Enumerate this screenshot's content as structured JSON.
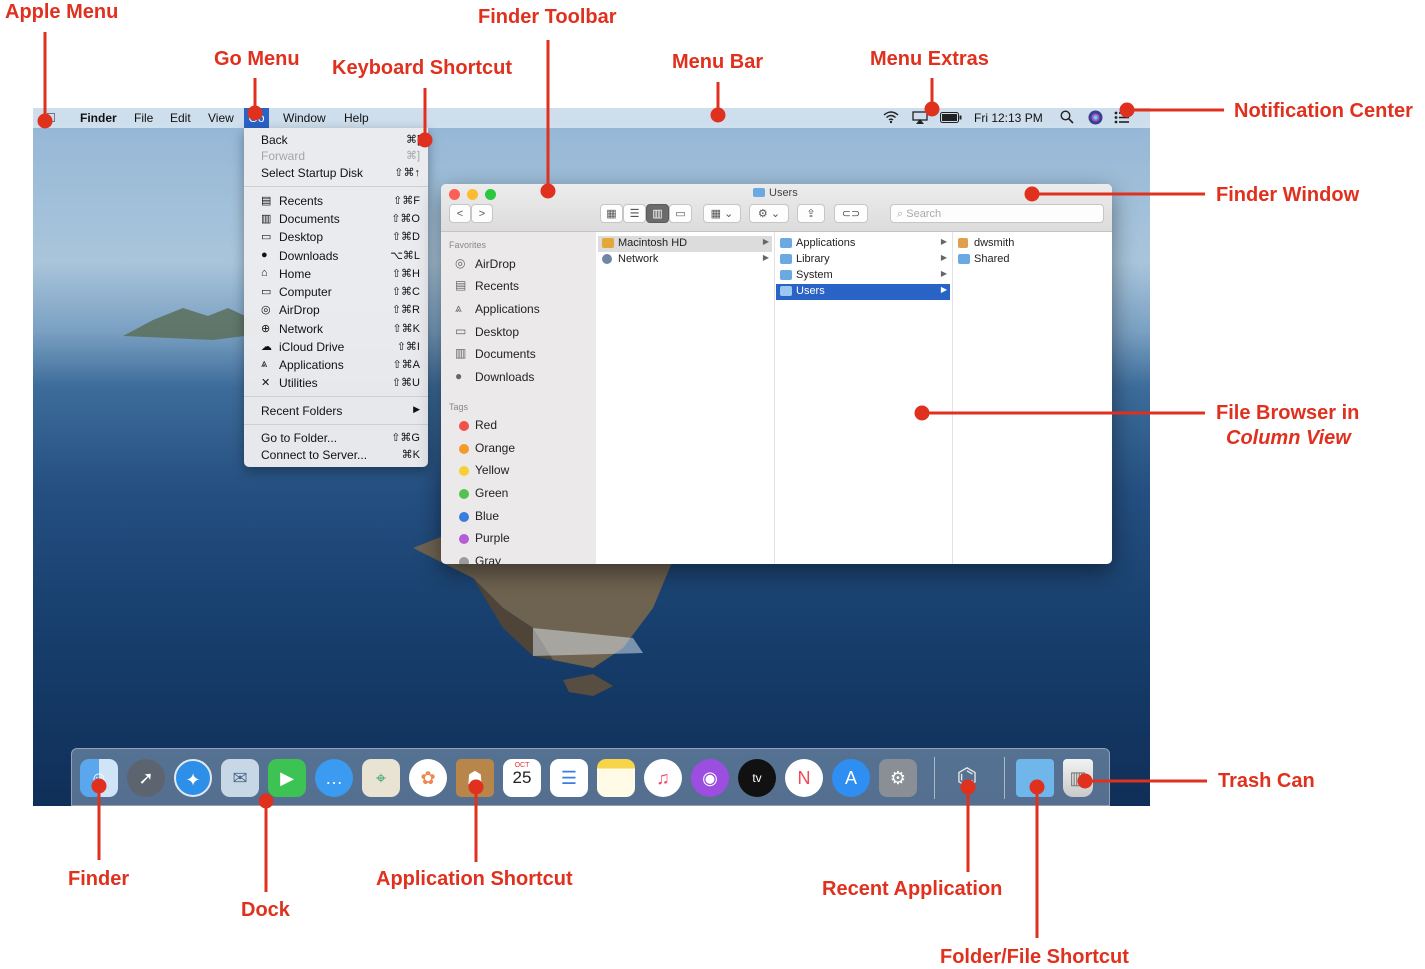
{
  "callouts": {
    "apple_menu": "Apple Menu",
    "go_menu": "Go Menu",
    "keyboard_shortcut": "Keyboard Shortcut",
    "finder_toolbar": "Finder Toolbar",
    "menu_bar": "Menu Bar",
    "menu_extras": "Menu Extras",
    "notification_center": "Notification Center",
    "finder_window": "Finder Window",
    "file_browser_line1": "File Browser in",
    "file_browser_line2": "Column View",
    "trash_can": "Trash Can",
    "finder": "Finder",
    "dock": "Dock",
    "application_shortcut": "Application Shortcut",
    "recent_application": "Recent Application",
    "folder_file_shortcut": "Folder/File Shortcut"
  },
  "menubar": {
    "apple": "",
    "app_name": "Finder",
    "items": [
      "File",
      "Edit",
      "View",
      "Go",
      "Window",
      "Help"
    ],
    "clock": "Fri 12:13 PM"
  },
  "go_menu": {
    "items": [
      {
        "label": "Back",
        "shortcut": "⌘[",
        "disabled": false
      },
      {
        "label": "Forward",
        "shortcut": "⌘]",
        "disabled": true
      },
      {
        "label": "Select Startup Disk",
        "shortcut": "⇧⌘↑",
        "disabled": false
      },
      {
        "label": "Recents",
        "shortcut": "⇧⌘F",
        "icon": "recents-icon"
      },
      {
        "label": "Documents",
        "shortcut": "⇧⌘O",
        "icon": "documents-icon"
      },
      {
        "label": "Desktop",
        "shortcut": "⇧⌘D",
        "icon": "desktop-icon"
      },
      {
        "label": "Downloads",
        "shortcut": "⌥⌘L",
        "icon": "downloads-icon"
      },
      {
        "label": "Home",
        "shortcut": "⇧⌘H",
        "icon": "home-icon"
      },
      {
        "label": "Computer",
        "shortcut": "⇧⌘C",
        "icon": "computer-icon"
      },
      {
        "label": "AirDrop",
        "shortcut": "⇧⌘R",
        "icon": "airdrop-icon"
      },
      {
        "label": "Network",
        "shortcut": "⇧⌘K",
        "icon": "network-icon"
      },
      {
        "label": "iCloud Drive",
        "shortcut": "⇧⌘I",
        "icon": "icloud-icon"
      },
      {
        "label": "Applications",
        "shortcut": "⇧⌘A",
        "icon": "applications-icon"
      },
      {
        "label": "Utilities",
        "shortcut": "⇧⌘U",
        "icon": "utilities-icon"
      },
      {
        "label": "Recent Folders",
        "shortcut": "▶"
      },
      {
        "label": "Go to Folder...",
        "shortcut": "⇧⌘G"
      },
      {
        "label": "Connect to Server...",
        "shortcut": "⌘K"
      }
    ]
  },
  "finder_window": {
    "title": "Users",
    "search_placeholder": "Search",
    "favorites_header": "Favorites",
    "favorites": [
      "AirDrop",
      "Recents",
      "Applications",
      "Desktop",
      "Documents",
      "Downloads"
    ],
    "tags_header": "Tags",
    "tags": [
      {
        "label": "Red",
        "color": "#f0524a"
      },
      {
        "label": "Orange",
        "color": "#f39a2b"
      },
      {
        "label": "Yellow",
        "color": "#f6cf34"
      },
      {
        "label": "Green",
        "color": "#55c24f"
      },
      {
        "label": "Blue",
        "color": "#3b7ddd"
      },
      {
        "label": "Purple",
        "color": "#b45ed6"
      },
      {
        "label": "Gray",
        "color": "#9b9b9b"
      }
    ],
    "column1": [
      "Macintosh HD",
      "Network"
    ],
    "column2": [
      "Applications",
      "Library",
      "System",
      "Users"
    ],
    "column3": [
      "dwsmith",
      "Shared"
    ],
    "selected_color": "#2a63c6"
  },
  "dock": {
    "calendar_month": "OCT",
    "calendar_day": "25",
    "tv_label": "tv"
  },
  "colors": {
    "callout_red": "#e0301e"
  }
}
